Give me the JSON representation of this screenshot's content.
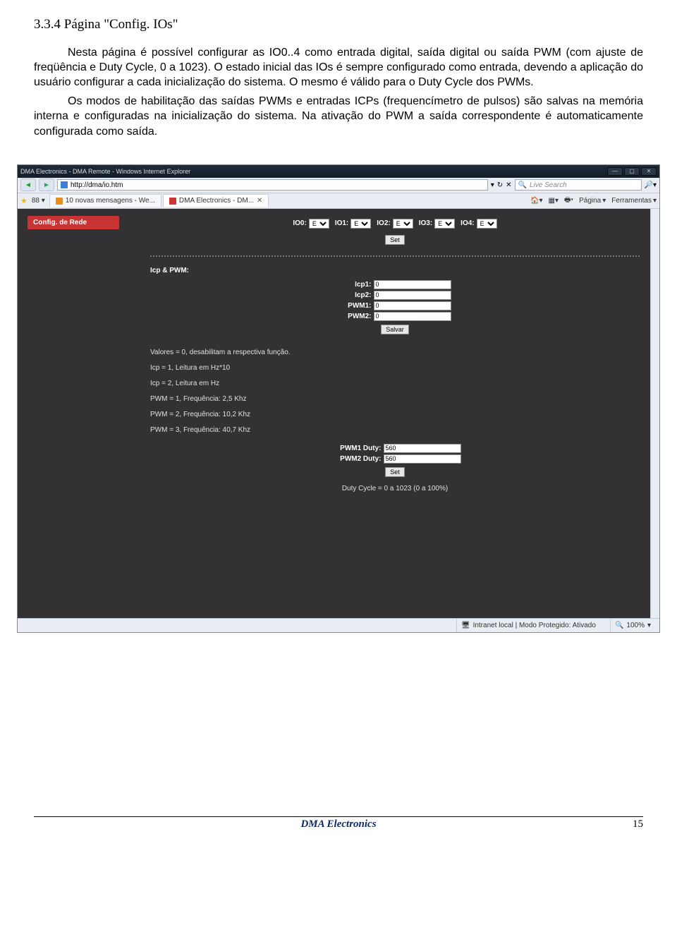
{
  "heading": "3.3.4 Página \"Config. IOs\"",
  "para1": "Nesta página é possível configurar as IO0..4 como entrada digital, saída digital ou saída PWM (com ajuste de freqüência e Duty Cycle, 0 a 1023). O estado inicial das IOs é sempre configurado como entrada, devendo a aplicação do usuário configurar a cada inicialização do sistema. O mesmo é válido para o Duty Cycle dos PWMs.",
  "para2": "Os modos de habilitação das saídas PWMs e entradas ICPs (frequencímetro de pulsos) são salvas na memória interna e configuradas na inicialização do sistema. Na ativação do PWM a saída correspondente é automaticamente configurada como saída.",
  "browser": {
    "title": "DMA Electronics - DMA Remote - Windows Internet Explorer",
    "url": "http://dma/io.htm",
    "search_placeholder": "Live Search",
    "tabs": [
      {
        "label": "10 novas mensagens - We..."
      },
      {
        "label": "DMA Electronics - DM..."
      }
    ],
    "tools": {
      "pagina": "Página",
      "ferramentas": "Ferramentas"
    },
    "status": {
      "zone": "Intranet local | Modo Protegido: Ativado",
      "zoom": "100%"
    }
  },
  "config": {
    "panel_header": "Config. de Rede",
    "ios": [
      {
        "label": "IO0:",
        "value": "E"
      },
      {
        "label": "IO1:",
        "value": "E"
      },
      {
        "label": "IO2:",
        "value": "E"
      },
      {
        "label": "IO3:",
        "value": "E"
      },
      {
        "label": "IO4:",
        "value": "E"
      }
    ],
    "set_label": "Set",
    "section_label": "Icp & PWM:",
    "fields": [
      {
        "label": "Icp1:",
        "value": "0"
      },
      {
        "label": "Icp2:",
        "value": "0"
      },
      {
        "label": "PWM1:",
        "value": "0"
      },
      {
        "label": "PWM2:",
        "value": "0"
      }
    ],
    "save_label": "Salvar",
    "notes": [
      "Valores = 0, desabilitam a respectiva função.",
      "Icp = 1, Leitura em Hz*10",
      "Icp = 2, Leitura em Hz",
      "PWM = 1, Frequência: 2,5 Khz",
      "PWM = 2, Frequência: 10,2 Khz",
      "PWM = 3, Frequência: 40,7 Khz"
    ],
    "duty": [
      {
        "label": "PWM1 Duty:",
        "value": "560"
      },
      {
        "label": "PWM2 Duty:",
        "value": "560"
      }
    ],
    "duty_set": "Set",
    "duty_note": "Duty Cycle = 0 a 1023 (0 a 100%)"
  },
  "footer": {
    "brand": "DMA Electronics",
    "page": "15"
  }
}
